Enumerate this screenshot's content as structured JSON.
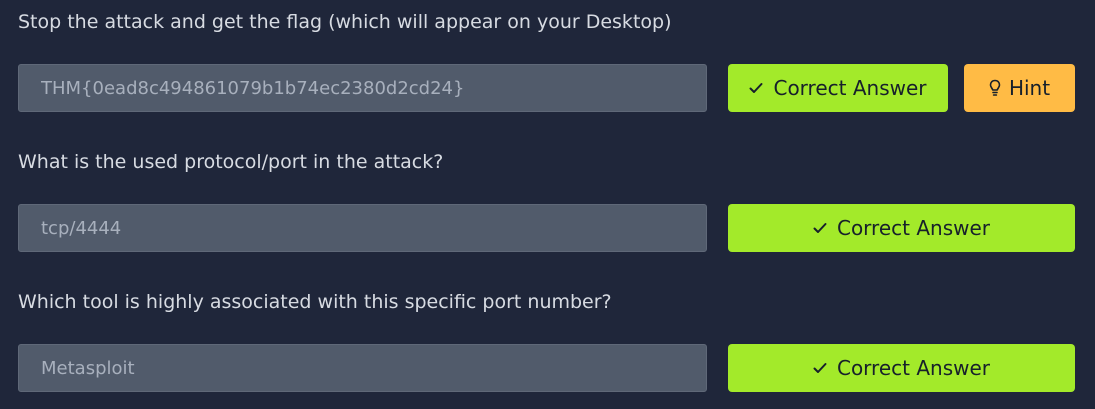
{
  "questions": [
    {
      "text": "Stop the attack and get the flag (which will appear on your Desktop)",
      "answer_value": "THM{0ead8c494861079b1b74ec2380d2cd24}",
      "submit_label": "Correct Answer",
      "hint_label": "Hint"
    },
    {
      "text": "What is the used protocol/port in the attack?",
      "answer_value": "tcp/4444",
      "submit_label": "Correct Answer"
    },
    {
      "text": "Which tool is highly associated with this specific port number?",
      "answer_value": "Metasploit",
      "submit_label": "Correct Answer"
    }
  ],
  "icons": {
    "correct": "check-icon",
    "hint": "lightbulb-icon"
  },
  "colors": {
    "background": "#1f263a",
    "input_background": "#515b6b",
    "correct_button": "#a3ea2a",
    "hint_button": "#ffbb45"
  }
}
